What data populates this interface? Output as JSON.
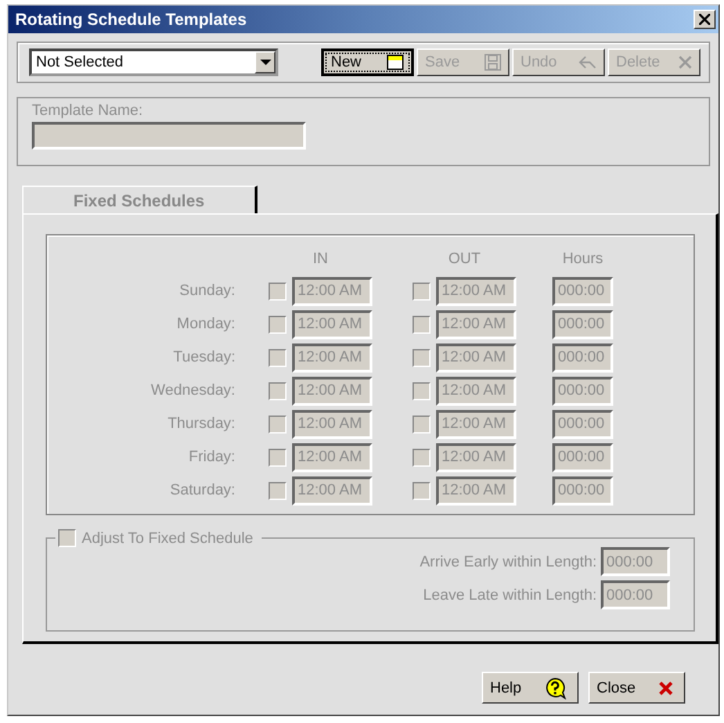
{
  "window": {
    "title": "Rotating Schedule Templates"
  },
  "template_select": {
    "value": "Not Selected"
  },
  "toolbar": [
    {
      "label": "New",
      "kind": "new",
      "disabled": false,
      "focused": true
    },
    {
      "label": "Save",
      "kind": "save",
      "disabled": true,
      "focused": false
    },
    {
      "label": "Undo",
      "kind": "undo",
      "disabled": true,
      "focused": false
    },
    {
      "label": "Delete",
      "kind": "delete",
      "disabled": true,
      "focused": false
    }
  ],
  "template_name": {
    "label": "Template Name:",
    "disabled": true
  },
  "tabs": [
    {
      "label": "Fixed Schedules",
      "selected": true
    }
  ],
  "schedule": {
    "disabled": true,
    "columns": [
      "IN",
      "OUT",
      "Hours"
    ],
    "rows": [
      {
        "day": "Sunday:",
        "in_checked": false,
        "in": "12:00 AM",
        "out_checked": false,
        "out": "12:00 AM",
        "hours": "000:00"
      },
      {
        "day": "Monday:",
        "in_checked": false,
        "in": "12:00 AM",
        "out_checked": false,
        "out": "12:00 AM",
        "hours": "000:00"
      },
      {
        "day": "Tuesday:",
        "in_checked": false,
        "in": "12:00 AM",
        "out_checked": false,
        "out": "12:00 AM",
        "hours": "000:00"
      },
      {
        "day": "Wednesday:",
        "in_checked": false,
        "in": "12:00 AM",
        "out_checked": false,
        "out": "12:00 AM",
        "hours": "000:00"
      },
      {
        "day": "Thursday:",
        "in_checked": false,
        "in": "12:00 AM",
        "out_checked": false,
        "out": "12:00 AM",
        "hours": "000:00"
      },
      {
        "day": "Friday:",
        "in_checked": false,
        "in": "12:00 AM",
        "out_checked": false,
        "out": "12:00 AM",
        "hours": "000:00"
      },
      {
        "day": "Saturday:",
        "in_checked": false,
        "in": "12:00 AM",
        "out_checked": false,
        "out": "12:00 AM",
        "hours": "000:00"
      }
    ]
  },
  "adjust": {
    "label": "Adjust To Fixed Schedule",
    "checked": false,
    "disabled": true,
    "fields": [
      {
        "label": "Arrive Early within Length:",
        "value": "000:00"
      },
      {
        "label": "Leave Late within Length:",
        "value": "000:00"
      }
    ]
  },
  "footer_buttons": [
    {
      "label": "Help",
      "kind": "help"
    },
    {
      "label": "Close",
      "kind": "close"
    }
  ]
}
